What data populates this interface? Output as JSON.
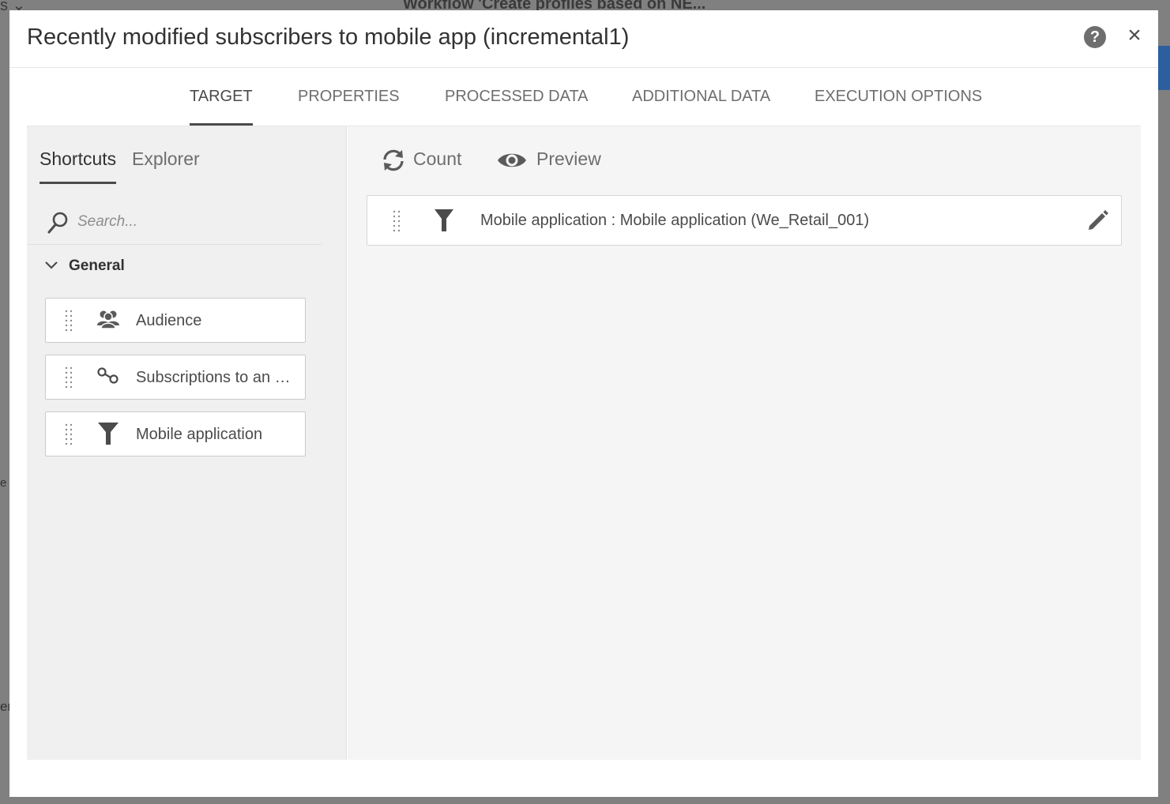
{
  "background": {
    "workflow_title": "Workflow 'Create profiles based on NE...",
    "side_text_1": "e",
    "side_text_2": "er"
  },
  "dialog": {
    "title": "Recently modified subscribers to mobile app (incremental1)",
    "help_label": "?",
    "close_label": "×"
  },
  "tabs": [
    {
      "label": "TARGET",
      "active": true
    },
    {
      "label": "PROPERTIES",
      "active": false
    },
    {
      "label": "PROCESSED DATA",
      "active": false
    },
    {
      "label": "ADDITIONAL DATA",
      "active": false
    },
    {
      "label": "EXECUTION OPTIONS",
      "active": false
    }
  ],
  "left_panel": {
    "subtabs": [
      {
        "label": "Shortcuts",
        "active": true
      },
      {
        "label": "Explorer",
        "active": false
      }
    ],
    "search": {
      "placeholder": "Search...",
      "value": ""
    },
    "group": {
      "label": "General",
      "expanded": true
    },
    "shortcuts": [
      {
        "label": "Audience",
        "icon": "audience-icon"
      },
      {
        "label": "Subscriptions to an …",
        "icon": "link-icon"
      },
      {
        "label": "Mobile application",
        "icon": "filter-icon"
      }
    ]
  },
  "right_panel": {
    "count_label": "Count",
    "preview_label": "Preview",
    "filter_row": {
      "label": "Mobile application : Mobile application (We_Retail_001)",
      "icon": "filter-icon"
    }
  },
  "colors": {
    "text_dark": "#323232",
    "text_muted": "#6e6e6e",
    "panel_left": "#f0f0f0",
    "panel_right": "#f5f5f5",
    "accent_blue": "#2d5f9e"
  }
}
